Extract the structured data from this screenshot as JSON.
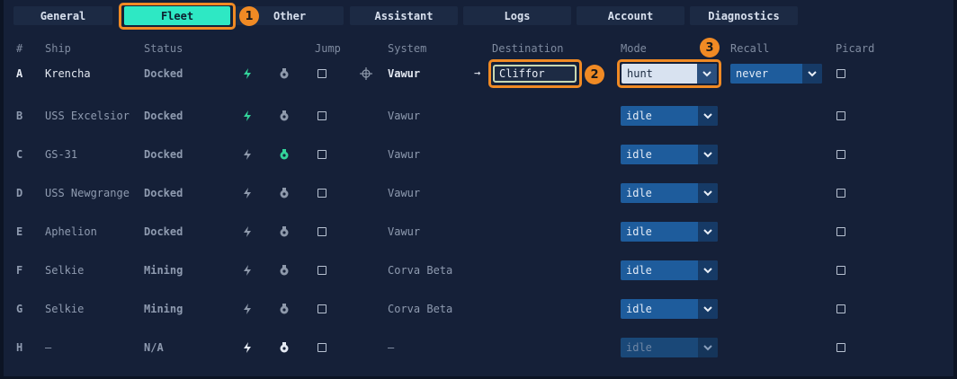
{
  "tabs": [
    {
      "label": "General"
    },
    {
      "label": "Fleet"
    },
    {
      "label": "Other"
    },
    {
      "label": "Assistant"
    },
    {
      "label": "Logs"
    },
    {
      "label": "Account"
    },
    {
      "label": "Diagnostics"
    }
  ],
  "active_tab": "Fleet",
  "callouts": [
    "1",
    "2",
    "3"
  ],
  "columns": {
    "id": "#",
    "ship": "Ship",
    "status": "Status",
    "jump": "Jump",
    "system": "System",
    "destination": "Destination",
    "mode": "Mode",
    "recall": "Recall",
    "picard": "Picard"
  },
  "rows": [
    {
      "id": "A",
      "ship": "Krencha",
      "status": "Docked",
      "system": "Vawur",
      "destination": "Cliffor",
      "mode": "hunt",
      "recall": "never"
    },
    {
      "id": "B",
      "ship": "USS Excelsior",
      "status": "Docked",
      "system": "Vawur",
      "mode": "idle"
    },
    {
      "id": "C",
      "ship": "GS-31",
      "status": "Docked",
      "system": "Vawur",
      "mode": "idle"
    },
    {
      "id": "D",
      "ship": "USS Newgrange",
      "status": "Docked",
      "system": "Vawur",
      "mode": "idle"
    },
    {
      "id": "E",
      "ship": "Aphelion",
      "status": "Docked",
      "system": "Vawur",
      "mode": "idle"
    },
    {
      "id": "F",
      "ship": "Selkie",
      "status": "Mining",
      "system": "Corva Beta",
      "mode": "idle"
    },
    {
      "id": "G",
      "ship": "Selkie",
      "status": "Mining",
      "system": "Corva Beta",
      "mode": "idle"
    },
    {
      "id": "H",
      "ship": "—",
      "status": "N/A",
      "system": "—",
      "mode": "idle"
    }
  ],
  "arrow_glyph": "→",
  "colors": {
    "accent": "#2ee8c4",
    "callout": "#f08a24",
    "select": "#1e5c9c"
  }
}
